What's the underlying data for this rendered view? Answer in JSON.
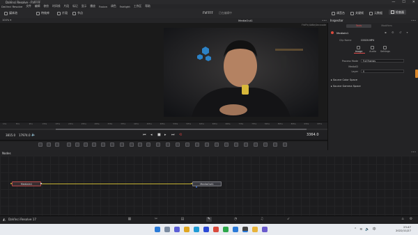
{
  "window": {
    "title": "DaVinci Resolve - FVFFFF",
    "controls": [
      "—",
      "☐",
      "✕"
    ]
  },
  "menu": [
    "DaVinci Resolve",
    "文件",
    "编辑",
    "修剪",
    "时间线",
    "片段",
    "标记",
    "显示",
    "播放",
    "Fusion",
    "调色",
    "Fairlight",
    "工作区",
    "帮助"
  ],
  "toolbar": {
    "left": [
      {
        "label": "媒体池",
        "icon": "media-pool-icon"
      },
      {
        "label": "特效库",
        "icon": "effects-icon"
      },
      {
        "label": "片段",
        "icon": "clips-icon"
      },
      {
        "label": "节点",
        "icon": "nodes-icon"
      }
    ],
    "project_title": "FVFFFF",
    "project_subtitle": "已在编辑中",
    "right": [
      {
        "label": "调音台",
        "icon": "mixer-icon"
      },
      {
        "label": "关键帧",
        "icon": "keyframes-icon"
      },
      {
        "label": "元数据",
        "icon": "metadata-icon"
      },
      {
        "label": "检查器",
        "icon": "inspector-icon"
      }
    ]
  },
  "viewer": {
    "zoom": "100% ▾",
    "name": "MediaOut1",
    "clip_label": "FhtFfc/4d6e/4ecccode",
    "menu_dots": "•••"
  },
  "ruler_ticks": [
    "1fra",
    "5fra",
    "9fra",
    "13fra",
    "17fra",
    "21fra",
    "25fra",
    "29fra",
    "33fra",
    "37fra",
    "41fra",
    "45fra",
    "49fra",
    "53fra",
    "57fra",
    "61fra",
    "65fra",
    "69fra",
    "73fra",
    "77fra",
    "81fra",
    "85fra",
    "89fra",
    "93fra",
    "97fra"
  ],
  "transport": {
    "tc_start": "3815.0",
    "tc_end": "17974.0",
    "current": "3364.0",
    "scrub_position": 0.17,
    "buttons": [
      "⏮",
      "◂",
      "■",
      "▸",
      "⏭",
      "⟲"
    ]
  },
  "nodes": {
    "label": "Nodes",
    "in": "MediaIn1",
    "out": "MediaOut1",
    "link_color": "#c7b333"
  },
  "inspector": {
    "title": "Inspector",
    "tab_tools": "Tools",
    "tab_modifiers": "Modifiers",
    "node_name": "MediaIn1",
    "clip_name_label": "Clip Name",
    "clip_name_value": "C0020.MP4",
    "subtabs": [
      "Image",
      "Audio",
      "Settings"
    ],
    "process_mode_label": "Process Mode",
    "process_mode_value": "Full Frames",
    "mediaid_label": "MediaID",
    "layer_label": "Layer",
    "layer_value": "0",
    "section1": "Source Color Space",
    "section2": "Source Gamma Space"
  },
  "pagebar": {
    "app_name": "DaVinci Resolve 17",
    "active_page": "fusion"
  },
  "taskbar": {
    "time": "23:47",
    "date": "2022/11/27"
  }
}
